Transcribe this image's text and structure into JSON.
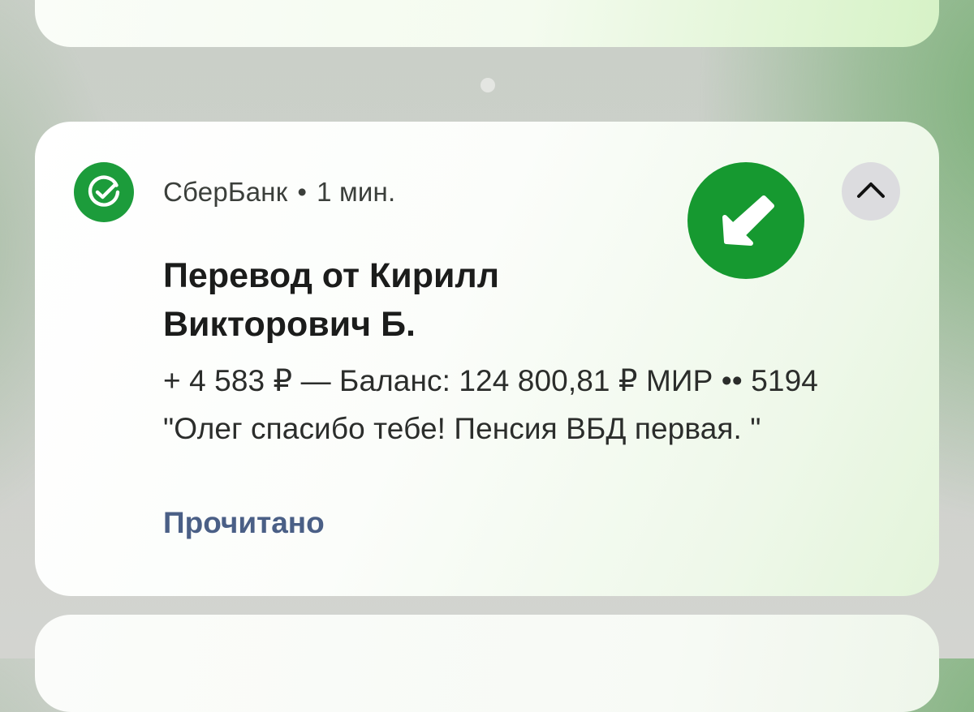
{
  "pager": {
    "dots": 1
  },
  "notification": {
    "app_icon": "sber-check-icon",
    "app_name": "СберБанк",
    "separator": "•",
    "time": "1 мин.",
    "badge_icon": "arrow-down-left-icon",
    "collapse_icon": "chevron-up-icon",
    "title": "Перевод от Кирилл Викторович Б.",
    "body_line1": "+ 4 583 ₽ — Баланс: 124 800,81 ₽ МИР •• 5194",
    "body_line2": "\"Олег спасибо тебе! Пенсия ВБД первая. \"",
    "action_label": "Прочитано"
  },
  "colors": {
    "brand_green": "#1c9c3b",
    "badge_green": "#169930",
    "action_blue": "#4a5f86"
  }
}
